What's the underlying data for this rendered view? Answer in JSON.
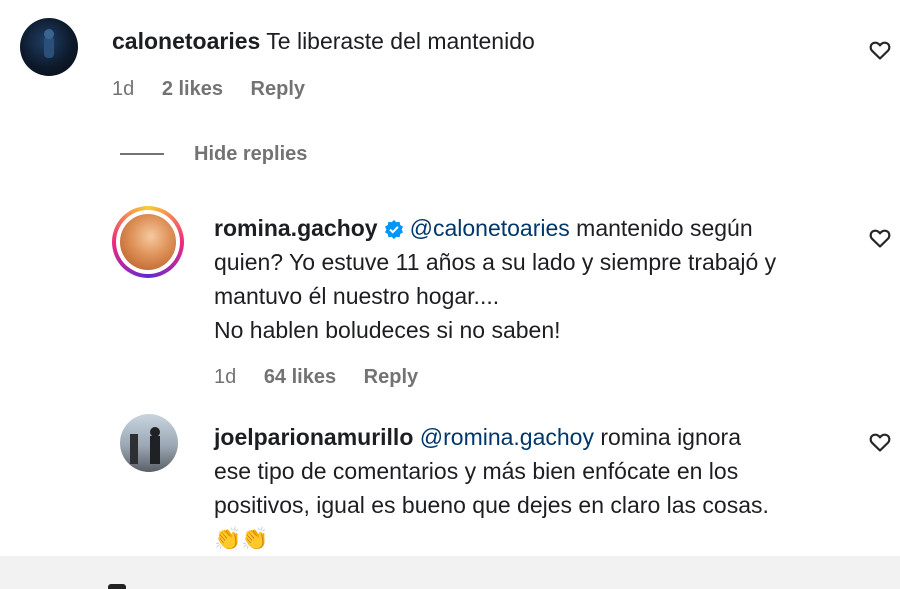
{
  "comments": [
    {
      "username": "calonetoaries",
      "text": "Te liberaste del mantenido",
      "time": "1d",
      "likes": "2 likes",
      "reply": "Reply",
      "avatar_icon": "person-silhouette-avatar"
    },
    {
      "username": "romina.gachoy",
      "verified": true,
      "mention": "@calonetoaries",
      "line1": "mantenido según",
      "line2": "quien? Yo estuve 11 años a su lado y siempre trabajó y",
      "line3": "mantuvo él nuestro hogar....",
      "line4": "No hablen boludeces si no saben!",
      "time": "1d",
      "likes": "64 likes",
      "reply": "Reply",
      "avatar_icon": "story-ring-avatar"
    },
    {
      "username": "joelparionamurillo",
      "mention": "@romina.gachoy",
      "line1": "romina ignora",
      "line2": "ese tipo de comentarios y más bien enfócate en los",
      "line3": "positivos, igual es bueno que dejes en claro las cosas.",
      "emoji": "👏👏",
      "avatar_icon": "outdoor-photo-avatar"
    }
  ],
  "hide_replies": "Hide replies",
  "colors": {
    "meta": "#737373",
    "mention": "#00376b",
    "verified": "#0095f6"
  }
}
